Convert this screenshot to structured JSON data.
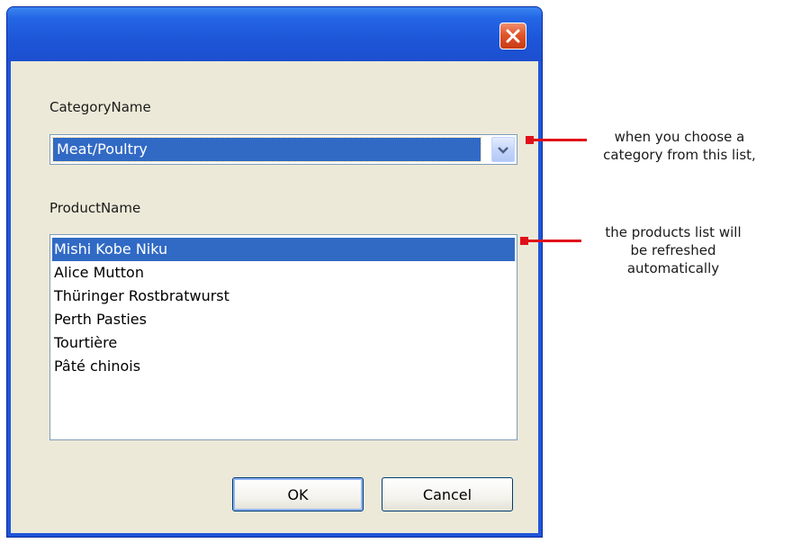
{
  "dialog": {
    "close_button": "close-icon"
  },
  "category": {
    "label": "CategoryName",
    "selected": "Meat/Poultry"
  },
  "product": {
    "label": "ProductName",
    "items": [
      "Mishi Kobe Niku",
      "Alice Mutton",
      "Thüringer Rostbratwurst",
      "Perth Pasties",
      "Tourtière",
      "Pâté chinois"
    ],
    "selected_index": 0
  },
  "buttons": {
    "ok": "OK",
    "cancel": "Cancel"
  },
  "callouts": {
    "category_line1": "when you choose a",
    "category_line2": "category from this list,",
    "product_line1": "the products list will",
    "product_line2": "be refreshed",
    "product_line3": "automatically"
  },
  "colors": {
    "titlebar": "#1f55d8",
    "selection": "#316ac5",
    "callout": "#e0101a",
    "dialog_face": "#ece9d8"
  }
}
